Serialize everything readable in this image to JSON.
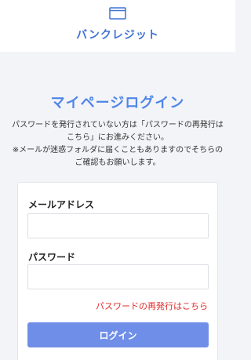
{
  "header": {
    "logo_icon": "card-icon",
    "logo_text": "バンクレジット",
    "brand_color": "#3f72d6"
  },
  "page": {
    "title": "マイページログイン",
    "notice_lines": [
      "パスワードを発行されていない方は「パスワードの再発行は",
      "こちら」にお進みください。",
      "※メールが迷惑フォルダに届くこともありますのでそちらの",
      "ご確認もお願いします。"
    ]
  },
  "form": {
    "email_label": "メールアドレス",
    "email_value": "",
    "password_label": "パスワード",
    "password_value": "",
    "reissue_link": "パスワードの再発行はこちら",
    "login_button": "ログイン"
  },
  "colors": {
    "title": "#4f86e8",
    "link": "#e32b2b",
    "button": "#6f8ee8"
  }
}
